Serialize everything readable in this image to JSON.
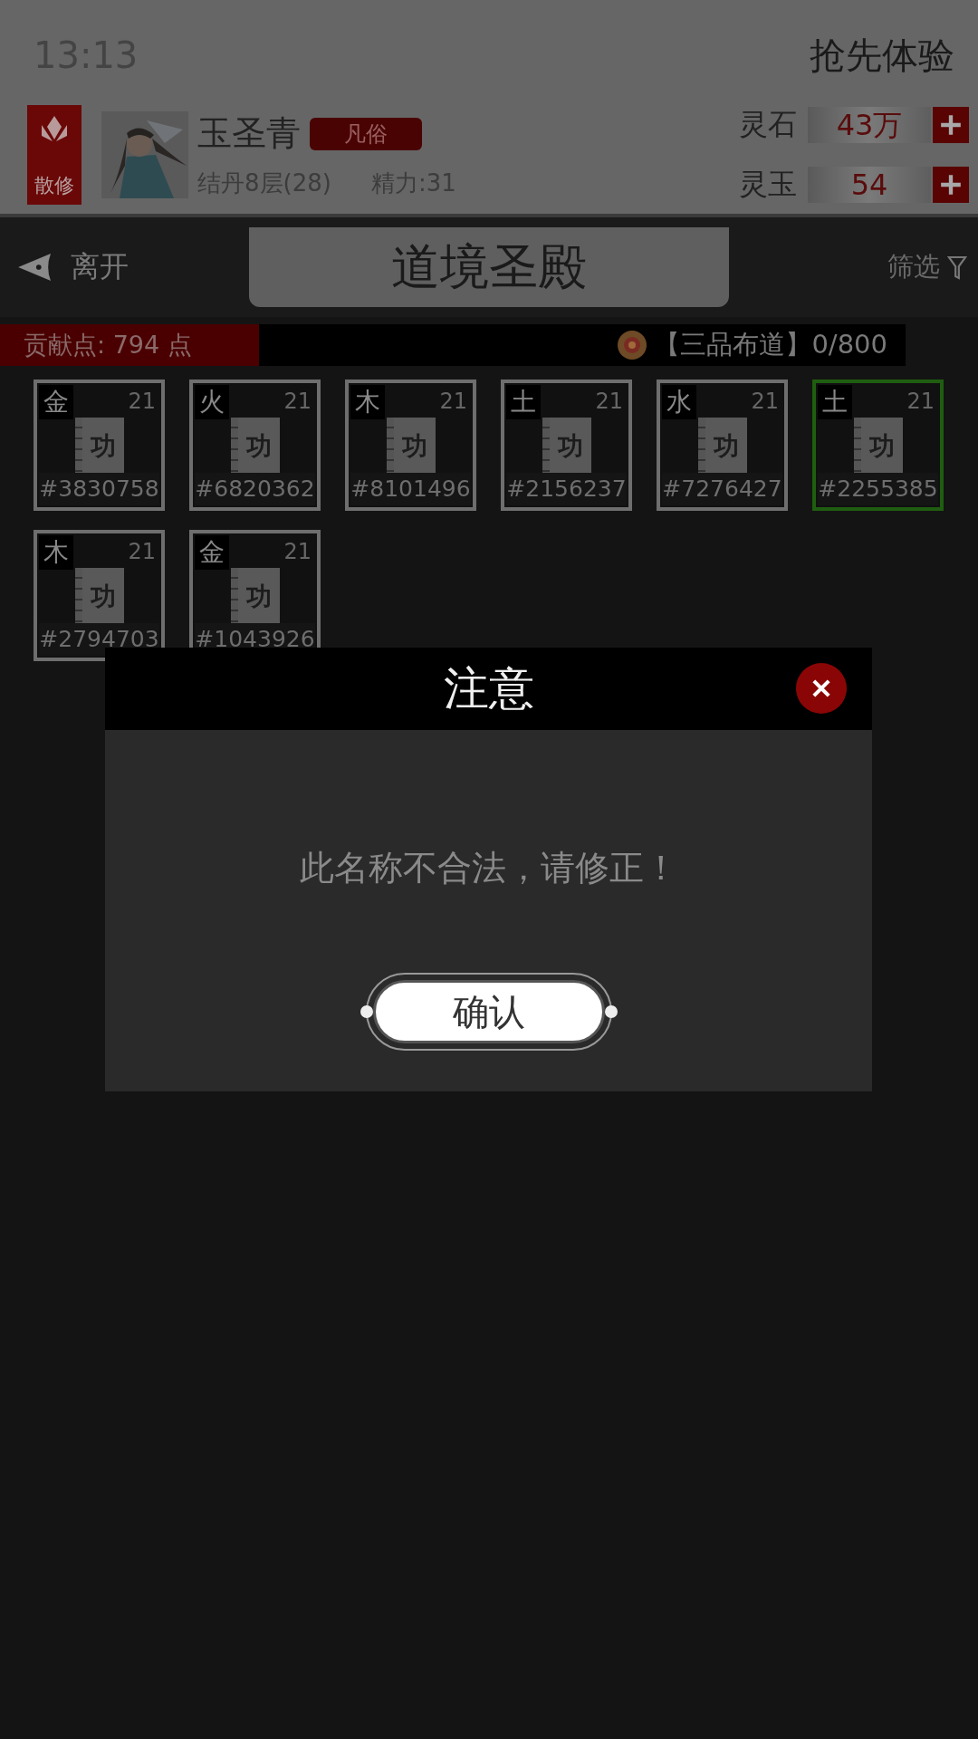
{
  "status_bar": {
    "time": "13:13",
    "label": "抢先体验"
  },
  "profile": {
    "sect": "散修",
    "name": "玉圣青",
    "rank_tag": "凡俗",
    "realm": "结丹8层(28)",
    "energy": "精力:31"
  },
  "currencies": [
    {
      "label": "灵石",
      "value": "43万"
    },
    {
      "label": "灵玉",
      "value": "54"
    }
  ],
  "nav": {
    "back": "离开",
    "title": "道境圣殿",
    "filter": "筛选"
  },
  "points_bar": {
    "points": "贡献点: 794 点",
    "rank": "【三品布道】0/800"
  },
  "cards": [
    {
      "element": "金",
      "level": "21",
      "glyph": "功",
      "code": "#3830758",
      "selected": false
    },
    {
      "element": "火",
      "level": "21",
      "glyph": "功",
      "code": "#6820362",
      "selected": false
    },
    {
      "element": "木",
      "level": "21",
      "glyph": "功",
      "code": "#8101496",
      "selected": false
    },
    {
      "element": "土",
      "level": "21",
      "glyph": "功",
      "code": "#2156237",
      "selected": false
    },
    {
      "element": "水",
      "level": "21",
      "glyph": "功",
      "code": "#7276427",
      "selected": false
    },
    {
      "element": "土",
      "level": "21",
      "glyph": "功",
      "code": "#2255385",
      "selected": true
    },
    {
      "element": "木",
      "level": "21",
      "glyph": "功",
      "code": "#2794703",
      "selected": false
    },
    {
      "element": "金",
      "level": "21",
      "glyph": "功",
      "code": "#1043926",
      "selected": false
    }
  ],
  "dialog": {
    "title": "注意",
    "message": "此名称不合法，请修正！",
    "confirm": "确认"
  }
}
